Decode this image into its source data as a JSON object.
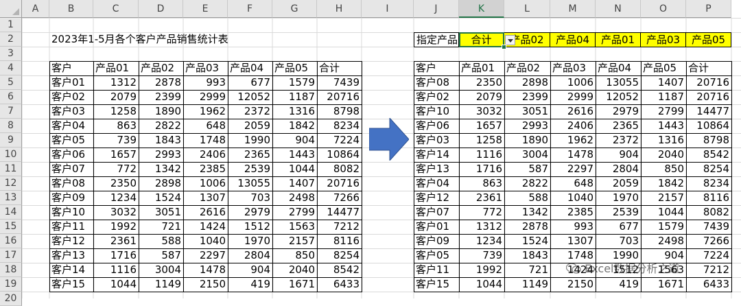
{
  "columns": [
    "A",
    "B",
    "C",
    "D",
    "E",
    "F",
    "G",
    "H",
    "I",
    "J",
    "K",
    "L",
    "M",
    "N",
    "O",
    "P"
  ],
  "rows": [
    "1",
    "2",
    "3",
    "4",
    "5",
    "6",
    "7",
    "8",
    "9",
    "10",
    "11",
    "12",
    "13",
    "14",
    "15",
    "16",
    "17",
    "18",
    "19",
    "20"
  ],
  "selected_column": "K",
  "title": "2023年1-5月各个客户产品销售统计表",
  "filter": {
    "label": "指定产品",
    "value": "合计",
    "options": [
      "产品02",
      "产品04",
      "产品01",
      "产品03",
      "产品05"
    ]
  },
  "headers": [
    "客户",
    "产品01",
    "产品02",
    "产品03",
    "产品04",
    "产品05",
    "合计"
  ],
  "left_table": [
    [
      "客户01",
      "1312",
      "2878",
      "993",
      "677",
      "1579",
      "7439"
    ],
    [
      "客户02",
      "2079",
      "2399",
      "2999",
      "12052",
      "1187",
      "20716"
    ],
    [
      "客户03",
      "1258",
      "1890",
      "1962",
      "2372",
      "1316",
      "8798"
    ],
    [
      "客户04",
      "863",
      "2822",
      "648",
      "2059",
      "1842",
      "8234"
    ],
    [
      "客户05",
      "739",
      "1843",
      "1748",
      "1990",
      "904",
      "7224"
    ],
    [
      "客户06",
      "1657",
      "2993",
      "2406",
      "2365",
      "1443",
      "10864"
    ],
    [
      "客户07",
      "772",
      "1342",
      "2385",
      "2539",
      "1044",
      "8082"
    ],
    [
      "客户08",
      "2350",
      "2898",
      "1006",
      "13055",
      "1407",
      "20716"
    ],
    [
      "客户09",
      "1234",
      "1524",
      "1307",
      "703",
      "2498",
      "7266"
    ],
    [
      "客户10",
      "3032",
      "3051",
      "2616",
      "2979",
      "2799",
      "14477"
    ],
    [
      "客户11",
      "1992",
      "721",
      "1424",
      "1512",
      "1563",
      "7212"
    ],
    [
      "客户12",
      "2361",
      "588",
      "1040",
      "1970",
      "2157",
      "8116"
    ],
    [
      "客户13",
      "1716",
      "587",
      "2297",
      "2804",
      "850",
      "8254"
    ],
    [
      "客户14",
      "1116",
      "3004",
      "1478",
      "904",
      "2040",
      "8542"
    ],
    [
      "客户15",
      "1044",
      "1149",
      "2150",
      "419",
      "1671",
      "6433"
    ]
  ],
  "right_table": [
    [
      "客户08",
      "2350",
      "2898",
      "1006",
      "13055",
      "1407",
      "20716"
    ],
    [
      "客户02",
      "2079",
      "2399",
      "2999",
      "12052",
      "1187",
      "20716"
    ],
    [
      "客户10",
      "3032",
      "3051",
      "2616",
      "2979",
      "2799",
      "14477"
    ],
    [
      "客户06",
      "1657",
      "2993",
      "2406",
      "2365",
      "1443",
      "10864"
    ],
    [
      "客户03",
      "1258",
      "1890",
      "1962",
      "2372",
      "1316",
      "8798"
    ],
    [
      "客户14",
      "1116",
      "3004",
      "1478",
      "904",
      "2040",
      "8542"
    ],
    [
      "客户13",
      "1716",
      "587",
      "2297",
      "2804",
      "850",
      "8254"
    ],
    [
      "客户04",
      "863",
      "2822",
      "648",
      "2059",
      "1842",
      "8234"
    ],
    [
      "客户12",
      "2361",
      "588",
      "1040",
      "1970",
      "2157",
      "8116"
    ],
    [
      "客户07",
      "772",
      "1342",
      "2385",
      "2539",
      "1044",
      "8082"
    ],
    [
      "客户01",
      "1312",
      "2878",
      "993",
      "677",
      "1579",
      "7439"
    ],
    [
      "客户09",
      "1234",
      "1524",
      "1307",
      "703",
      "2498",
      "7266"
    ],
    [
      "客户05",
      "739",
      "1843",
      "1748",
      "1990",
      "904",
      "7224"
    ],
    [
      "客户11",
      "1992",
      "721",
      "1424",
      "1512",
      "1563",
      "7212"
    ],
    [
      "客户15",
      "1044",
      "1149",
      "2150",
      "419",
      "1671",
      "6433"
    ]
  ],
  "watermark": "Excel数据分析之道",
  "colors": {
    "arrow": "#4472c4",
    "highlight": "#ffff00",
    "selection": "#217346"
  }
}
